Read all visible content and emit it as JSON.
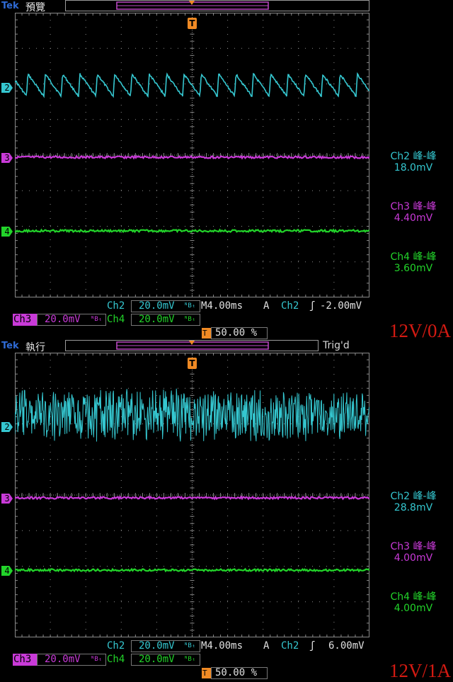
{
  "colors": {
    "ch2": "#35c7d0",
    "ch3": "#c93ad8",
    "ch4": "#22d42a",
    "trigger": "#f08a24",
    "grid": "#8a8a8a",
    "tek": "#2f6bd6",
    "label": "#d21a12"
  },
  "screens": [
    {
      "brand": "Tek",
      "mode": "預覽",
      "trig_state": "",
      "markers": {
        "ch2": "2",
        "ch3": "3",
        "ch4": "4",
        "trigger": "T"
      },
      "measurements": [
        {
          "name": "Ch2 峰-峰",
          "value": "18.0mV",
          "channel": "ch2"
        },
        {
          "name": "Ch3 峰-峰",
          "value": "4.40mV",
          "channel": "ch3"
        },
        {
          "name": "Ch4 峰-峰",
          "value": "3.60mV",
          "channel": "ch4"
        }
      ],
      "ch2_scale": "Ch2",
      "ch2_value": "20.0mV",
      "bw": "ᴺBₜ",
      "timebase": "M4.00ms",
      "trig_src_label": "A",
      "trig_ch": "Ch2",
      "trig_slope": "ʃ",
      "trig_level": "-2.00mV",
      "ch3_scale": "Ch3",
      "ch3_value": "20.0mV",
      "ch4_scale": "Ch4",
      "ch4_value": "20.0mV",
      "trig_pos": "50.00 %",
      "condition": "12V/0A"
    },
    {
      "brand": "Tek",
      "mode": "執行",
      "trig_state": "Trig'd",
      "markers": {
        "ch2": "2",
        "ch3": "3",
        "ch4": "4",
        "trigger": "T"
      },
      "measurements": [
        {
          "name": "Ch2 峰-峰",
          "value": "28.8mV",
          "channel": "ch2"
        },
        {
          "name": "Ch3 峰-峰",
          "value": "4.00mV",
          "channel": "ch3"
        },
        {
          "name": "Ch4 峰-峰",
          "value": "4.00mV",
          "channel": "ch4"
        }
      ],
      "ch2_scale": "Ch2",
      "ch2_value": "20.0mV",
      "bw": "ᴺBₜ",
      "timebase": "M4.00ms",
      "trig_src_label": "A",
      "trig_ch": "Ch2",
      "trig_slope": "ʃ",
      "trig_level": "6.00mV",
      "ch3_scale": "Ch3",
      "ch3_value": "20.0mV",
      "ch4_scale": "Ch4",
      "ch4_value": "20.0mV",
      "trig_pos": "50.00 %",
      "condition": "12V/1A"
    }
  ]
}
